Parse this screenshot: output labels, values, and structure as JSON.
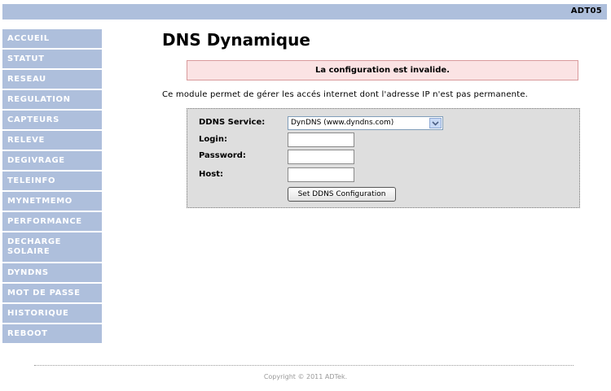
{
  "header": {
    "device": "ADT05"
  },
  "sidebar": {
    "items": [
      {
        "label": "ACCUEIL"
      },
      {
        "label": "STATUT"
      },
      {
        "label": "RESEAU"
      },
      {
        "label": "REGULATION"
      },
      {
        "label": "CAPTEURS"
      },
      {
        "label": "RELEVE"
      },
      {
        "label": "DEGIVRAGE"
      },
      {
        "label": "TELEINFO"
      },
      {
        "label": "MYNETMEMO"
      },
      {
        "label": "PERFORMANCE"
      },
      {
        "label_line1": "DECHARGE",
        "label_line2": "SOLAIRE"
      },
      {
        "label": "DYNDNS"
      },
      {
        "label": "MOT DE PASSE"
      },
      {
        "label": "HISTORIQUE"
      },
      {
        "label": "REBOOT"
      }
    ]
  },
  "main": {
    "title": "DNS Dynamique",
    "alert": "La configuration est invalide.",
    "description": "Ce module permet de gérer les accés internet dont l'adresse IP n'est pas permanente.",
    "form": {
      "service_label": "DDNS Service:",
      "service_value": "DynDNS (www.dyndns.com)",
      "login_label": "Login:",
      "login_value": "",
      "password_label": "Password:",
      "password_value": "",
      "host_label": "Host:",
      "host_value": "",
      "submit_label": "Set DDNS Configuration"
    }
  },
  "footer": {
    "copyright": "Copyright © 2011 ADTek."
  },
  "colors": {
    "nav_background": "#aebfdc",
    "alert_background": "#fbe3e4",
    "form_background": "#dedede"
  }
}
